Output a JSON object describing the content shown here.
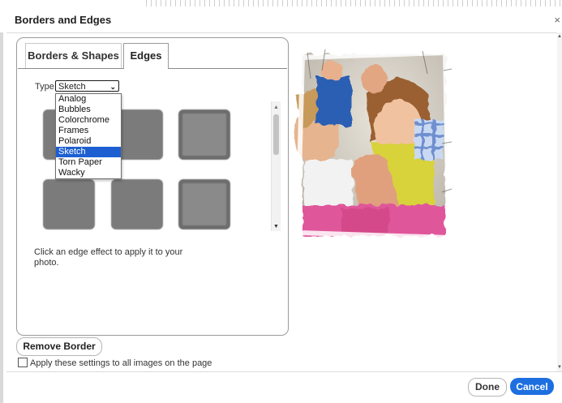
{
  "dialog": {
    "title": "Borders and Edges",
    "close": "×"
  },
  "tabs": [
    {
      "label": "Borders & Shapes"
    },
    {
      "label": "Edges"
    }
  ],
  "edges": {
    "type_label": "Type",
    "selected": "Sketch",
    "options": [
      "Analog",
      "Bubbles",
      "Colorchrome",
      "Frames",
      "Polaroid",
      "Sketch",
      "Torn Paper",
      "Wacky"
    ],
    "hint": "Click an edge effect to apply it to your photo."
  },
  "actions": {
    "remove_border": "Remove Border",
    "apply_all": "Apply these settings to all images on the page",
    "done": "Done",
    "cancel": "Cancel"
  },
  "colors": {
    "accent": "#1d6fe0",
    "selected_option": "#1d5fd1",
    "thumb_gray": "#7b7b7b"
  },
  "icons": {
    "close": "close-icon",
    "dropdown": "chevron-down-icon"
  }
}
